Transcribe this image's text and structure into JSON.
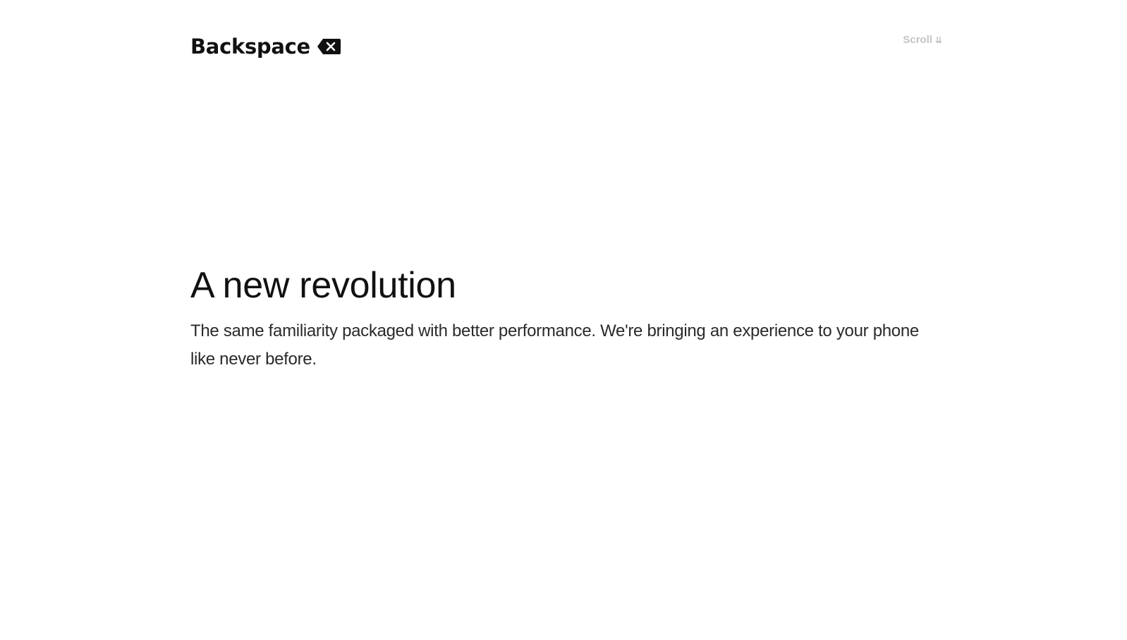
{
  "header": {
    "logo_text": "Backspace",
    "logo_icon": "backspace-key-icon",
    "scroll_label": "Scroll",
    "scroll_icon": "double-chevron-down-icon"
  },
  "hero": {
    "title": "A new revolution",
    "subtitle": "The same familiarity packaged with better performance. We're bringing an experience to your phone like never before."
  },
  "colors": {
    "background": "#ffffff",
    "text_primary": "#111111",
    "text_body": "#2a2a2a",
    "scroll_link": "#c4c4c4"
  }
}
